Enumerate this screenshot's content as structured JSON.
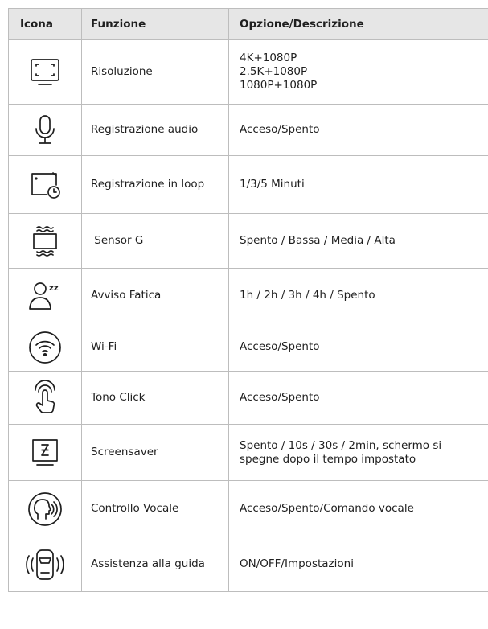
{
  "header": {
    "icon": "Icona",
    "function": "Funzione",
    "description": "Opzione/Descrizione"
  },
  "rows": [
    {
      "icon": "resolution-icon",
      "function": "Risoluzione",
      "description_lines": [
        "4K+1080P",
        "2.5K+1080P",
        "1080P+1080P"
      ]
    },
    {
      "icon": "microphone-icon",
      "function": "Registrazione audio",
      "description": "Acceso/Spento"
    },
    {
      "icon": "loop-recording-icon",
      "function": "Registrazione in loop",
      "description": "1/3/5 Minuti"
    },
    {
      "icon": "g-sensor-icon",
      "function": " Sensor G",
      "description": "Spento / Bassa / Media / Alta"
    },
    {
      "icon": "fatigue-alert-icon",
      "function": "Avviso Fatica",
      "description": "1h / 2h / 3h / 4h / Spento"
    },
    {
      "icon": "wifi-icon",
      "function": "Wi-Fi",
      "description": "Acceso/Spento"
    },
    {
      "icon": "touch-click-icon",
      "function": "Tono Click",
      "description": "Acceso/Spento"
    },
    {
      "icon": "screensaver-icon",
      "function": "Screensaver",
      "description": "Spento / 10s / 30s / 2min, schermo si spegne dopo il tempo impostato"
    },
    {
      "icon": "voice-control-icon",
      "function": "Controllo Vocale",
      "description": "Acceso/Spento/Comando vocale"
    },
    {
      "icon": "driving-assist-icon",
      "function": "Assistenza alla guida",
      "description": "ON/OFF/Impostazioni"
    }
  ]
}
